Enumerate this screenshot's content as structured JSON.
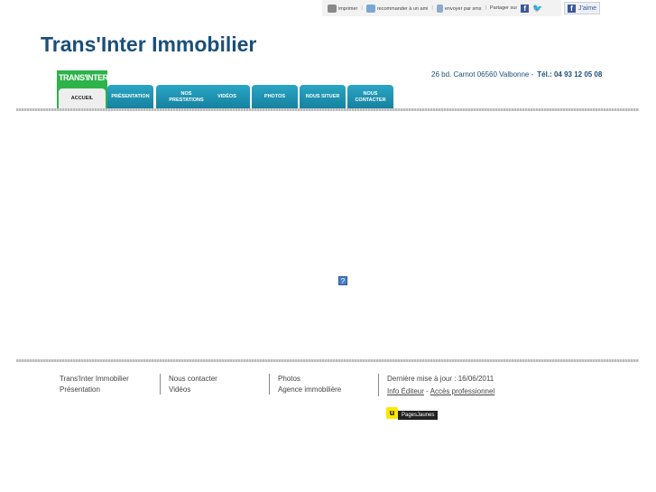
{
  "topbar": {
    "print": "imprimer",
    "recommend": "recommander à un ami",
    "send": "envoyer par sms",
    "share": "Partager sur",
    "like": "J'aime"
  },
  "header": {
    "title": "Trans'Inter Immobilier",
    "logo": "TRANS'INTER",
    "address": "26 bd. Carnot 06560 Valbonne  -",
    "phone": "Tél.: 04 93 12 05 08"
  },
  "nav": [
    {
      "label": "ACCUEIL"
    },
    {
      "label": "PRÉSENTATION"
    },
    {
      "label": "NOS PRESTATIONS"
    },
    {
      "label": "VIDÉOS"
    },
    {
      "label": "PHOTOS"
    },
    {
      "label": "NOUS SITUER"
    },
    {
      "label": "NOUS CONTACTER"
    }
  ],
  "main": {
    "placeholder_icon": "?"
  },
  "footer": {
    "col1": [
      "Trans'Inter Immobilier",
      "Présentation"
    ],
    "col2": [
      "Nous contacter",
      "Vidéos"
    ],
    "col3": [
      "Photos",
      "Agence immobilière"
    ],
    "updated": "Dernière mise à jour : 16/06/2011",
    "info": "Info Éditeur",
    "dash": "-",
    "pro": "Accès professionnel",
    "pj": "PagesJaunes"
  }
}
